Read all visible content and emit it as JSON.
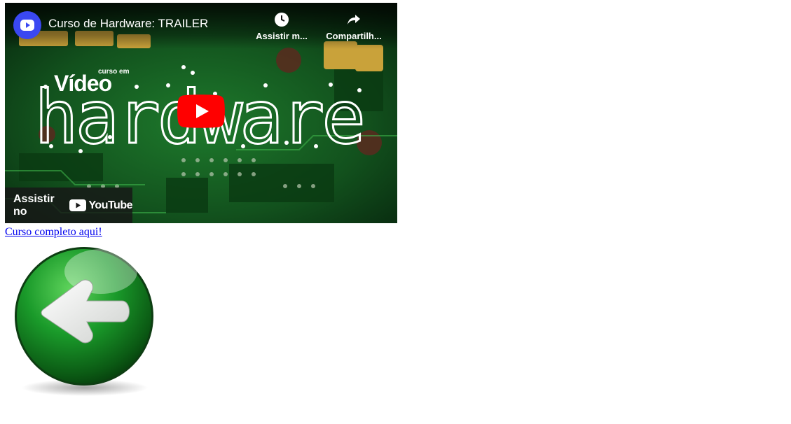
{
  "video": {
    "title": "Curso de Hardware: TRAILER",
    "channel_avatar_icon": "play-logo-icon",
    "actions": {
      "watch_later_label": "Assistir m...",
      "share_label": "Compartilh..."
    },
    "thumbnail": {
      "brand_small": "curso em",
      "brand_word": "Vídeo",
      "logo_word": "hardware"
    },
    "watch_on": {
      "label": "Assistir no",
      "platform": "YouTube"
    },
    "play_button_color": "#ff0000"
  },
  "link": {
    "text": "Curso completo aqui!"
  },
  "back_button": {
    "icon": "green-back-arrow-icon",
    "color": "#1a9a2a"
  }
}
